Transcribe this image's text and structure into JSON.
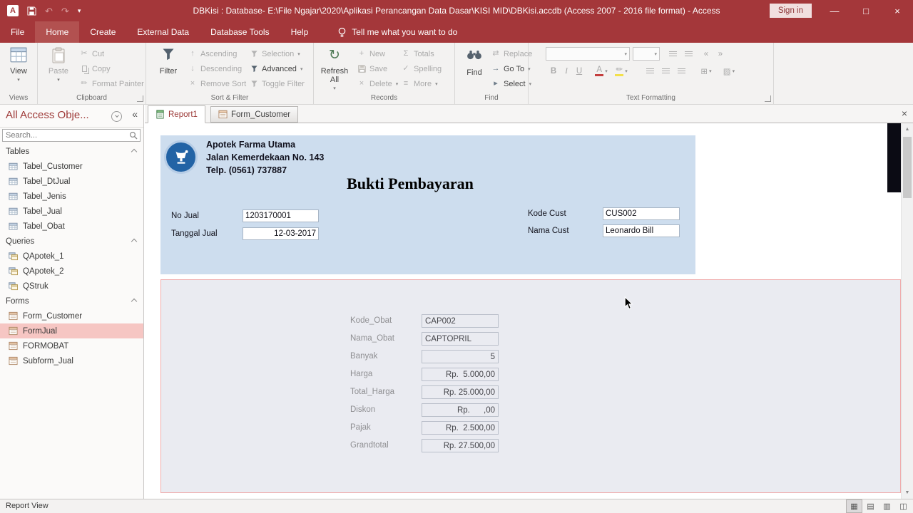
{
  "colors": {
    "accent": "#A4373A",
    "ribbon_bg": "#f3f2f1",
    "report_header_bg": "#cdddee",
    "detail_bg": "#eaebf1",
    "detail_border": "#efabab",
    "nav_selection_bg": "#f6c6c3"
  },
  "icons": {
    "undo": "↶",
    "redo": "↷",
    "dropdown": "▾",
    "minimize": "—",
    "maximize": "□",
    "close": "×",
    "cut": "✂",
    "format_painter": "✏",
    "ascending": "↑",
    "descending": "↓",
    "remove_sort": "×",
    "refresh": "↻",
    "new": "+",
    "delete": "×",
    "totals": "Σ",
    "spelling": "✓",
    "more": "≡",
    "replace": "⇄",
    "go_to": "→",
    "select": "▸",
    "font_color": "A",
    "highlight": "✏",
    "gridlines": "⊞",
    "fill": "▨",
    "indent_left": "«",
    "indent_right": "»",
    "collapse_pane": "«",
    "doc_close": "×",
    "scroll_up": "▲",
    "scroll_down": "▼",
    "view_shortcuts": [
      "▦",
      "▤",
      "▥",
      "◫"
    ]
  },
  "titlebar": {
    "app_icon": "A",
    "title": "DBKisi : Database- E:\\File Ngajar\\2020\\Aplikasi Perancangan Data Dasar\\KISI MID\\DBKisi.accdb (Access 2007 - 2016 file format) - Access",
    "sign_in": "Sign in"
  },
  "ribbon": {
    "tabs": [
      "File",
      "Home",
      "Create",
      "External Data",
      "Database Tools",
      "Help"
    ],
    "tell_me": "Tell me what you want to do",
    "groups": [
      "Views",
      "Clipboard",
      "Sort & Filter",
      "Records",
      "Find",
      "Text Formatting"
    ],
    "views": {
      "view": "View"
    },
    "clipboard": {
      "paste": "Paste",
      "cut": "Cut",
      "copy": "Copy",
      "format_painter": "Format Painter"
    },
    "sort_filter": {
      "filter": "Filter",
      "ascending": "Ascending",
      "descending": "Descending",
      "remove_sort": "Remove Sort",
      "selection": "Selection",
      "advanced": "Advanced",
      "toggle_filter": "Toggle Filter"
    },
    "records": {
      "refresh_all": "Refresh All",
      "new": "New",
      "save": "Save",
      "delete": "Delete",
      "totals": "Totals",
      "spelling": "Spelling",
      "more": "More"
    },
    "find": {
      "find": "Find",
      "replace": "Replace",
      "go_to": "Go To",
      "select": "Select"
    },
    "text_formatting": {
      "bold": "B",
      "italic": "I",
      "underline": "U"
    }
  },
  "nav": {
    "title": "All Access Obje...",
    "search_placeholder": "Search...",
    "sections": [
      {
        "label": "Tables",
        "items": [
          "Tabel_Customer",
          "Tabel_DtJual",
          "Tabel_Jenis",
          "Tabel_Jual",
          "Tabel_Obat"
        ]
      },
      {
        "label": "Queries",
        "items": [
          "QApotek_1",
          "QApotek_2",
          "QStruk"
        ]
      },
      {
        "label": "Forms",
        "items": [
          "Form_Customer",
          "FormJual",
          "FORMOBAT",
          "Subform_Jual"
        ]
      }
    ],
    "selected_item": "FormJual"
  },
  "doc_tabs": [
    "Report1",
    "Form_Customer"
  ],
  "report": {
    "company": {
      "name": "Apotek Farma Utama",
      "address": "Jalan Kemerdekaan No. 143",
      "phone": "Telp. (0561) 737887"
    },
    "title": "Bukti Pembayaran",
    "header_fields": {
      "no_jual_label": "No Jual",
      "no_jual": "1203170001",
      "tanggal_label": "Tanggal Jual",
      "tanggal": "12-03-2017",
      "kode_cust_label": "Kode Cust",
      "kode_cust": "CUS002",
      "nama_cust_label": "Nama Cust",
      "nama_cust": "Leonardo Bill"
    },
    "detail": [
      {
        "label": "Kode_Obat",
        "value": "CAP002"
      },
      {
        "label": "Nama_Obat",
        "value": "CAPTOPRIL"
      },
      {
        "label": "Banyak",
        "value": "5"
      },
      {
        "label": "Harga",
        "value": "Rp.  5.000,00"
      },
      {
        "label": "Total_Harga",
        "value": "Rp. 25.000,00"
      },
      {
        "label": "Diskon",
        "value": "Rp.      ,00"
      },
      {
        "label": "Pajak",
        "value": "Rp.  2.500,00"
      },
      {
        "label": "Grandtotal",
        "value": "Rp. 27.500,00"
      }
    ]
  },
  "status": {
    "view": "Report View"
  }
}
